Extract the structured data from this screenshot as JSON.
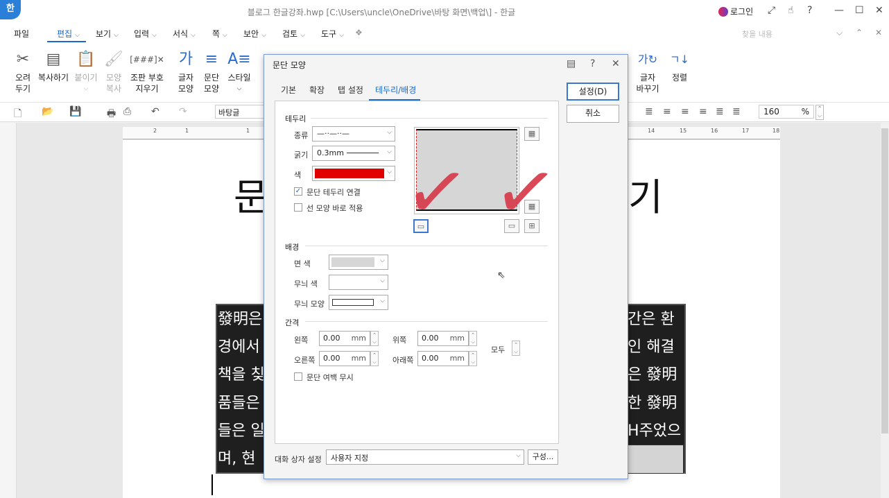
{
  "window": {
    "app_icon": "한",
    "title": "블로그 한글강좌.hwp [C:\\Users\\uncle\\OneDrive\\바탕 화면\\백업\\] - 한글",
    "login": "로그인"
  },
  "menus": [
    "파일",
    "편집",
    "보기",
    "입력",
    "서식",
    "쪽",
    "보안",
    "검토",
    "도구"
  ],
  "search_placeholder": "찾을 내용",
  "ribbon": [
    {
      "label1": "오려",
      "label2": "두기",
      "icon": "scissors-icon"
    },
    {
      "label1": "복사하기",
      "label2": "",
      "icon": "copy-icon"
    },
    {
      "label1": "붙이기",
      "label2": "",
      "icon": "paste-icon"
    },
    {
      "label1": "모양",
      "label2": "복사",
      "icon": "format-painter-icon"
    },
    {
      "label1": "조판 부호",
      "label2": "지우기",
      "icon": "clear-codes-icon"
    },
    {
      "label1": "글자",
      "label2": "모양",
      "icon": "char-shape-icon"
    },
    {
      "label1": "문단",
      "label2": "모양",
      "icon": "para-shape-icon"
    },
    {
      "label1": "스타일",
      "label2": "",
      "icon": "style-icon"
    },
    {
      "label1": "글자",
      "label2": "바꾸기",
      "icon": "char-replace-icon"
    },
    {
      "label1": "정렬",
      "label2": "",
      "icon": "sort-icon"
    }
  ],
  "toolbar": {
    "style_value": "바탕글",
    "zoom_value": "160",
    "zoom_unit": "%"
  },
  "ruler_numbers": [
    "2",
    "1",
    "1",
    "14",
    "15",
    "16",
    "17",
    "18"
  ],
  "document": {
    "title_left": "문",
    "title_right": "기",
    "lines_left": [
      "發明은",
      "경에서",
      "책을 칮",
      "품들은",
      "들은 일",
      "며, 현"
    ],
    "lines_right": [
      "간은 환",
      "인 해결",
      "은 發明",
      "한 發明",
      "H주었으",
      ""
    ]
  },
  "dialog": {
    "title": "문단 모양",
    "tabs": [
      "기본",
      "확장",
      "탭 설정",
      "테두리/배경"
    ],
    "border": {
      "section": "테두리",
      "type_label": "종류",
      "type_value": "—··—··—",
      "width_label": "굵기",
      "width_value": "0.3mm",
      "color_label": "색",
      "color_value": "#e00000",
      "connect_label": "문단 테두리 연결",
      "connect_checked": true,
      "apply_label": "선 모양 바로 적용",
      "apply_checked": false
    },
    "background": {
      "section": "배경",
      "face_label": "면 색",
      "pattern_color_label": "무늬 색",
      "pattern_shape_label": "무늬 모양"
    },
    "spacing": {
      "section": "간격",
      "left_label": "왼쪽",
      "left_value": "0.00",
      "top_label": "위쪽",
      "top_value": "0.00",
      "right_label": "오른쪽",
      "right_value": "0.00",
      "bottom_label": "아래쪽",
      "bottom_value": "0.00",
      "unit": "mm",
      "all_label": "모두",
      "ignore_margin_label": "문단 여백 무시"
    },
    "preset_label": "대화 상자 설정",
    "preset_value": "사용자 지정",
    "config_button": "구성...",
    "ok_button": "설정(D)",
    "cancel_button": "취소"
  }
}
